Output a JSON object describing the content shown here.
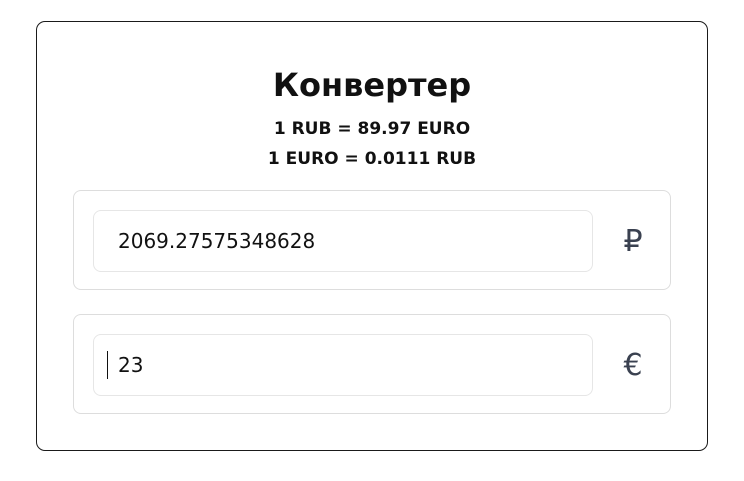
{
  "converter": {
    "title": "Конвертер",
    "rate_rub_to_euro": "1 RUB = 89.97 EURO",
    "rate_euro_to_rub": "1 EURO = 0.0111 RUB"
  },
  "rub_row": {
    "value": "2069.27575348628",
    "currency_icon": "ruble-icon",
    "currency_symbol": "₽"
  },
  "euro_row": {
    "value": "23",
    "currency_icon": "euro-icon",
    "currency_symbol": "€"
  }
}
